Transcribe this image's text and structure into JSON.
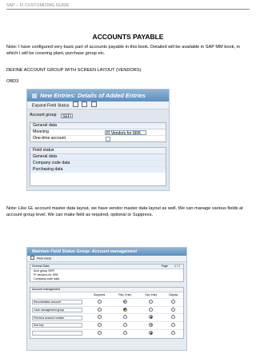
{
  "header": {
    "running_title": "SAP – FI CUSTOMIZING GUIDE"
  },
  "doc": {
    "title": "ACCOUNTS PAYABLE",
    "intro": "Note: I have configured very basic part of accounts payable in this book. Detailed will be available in SAP MM book, in which I will be covering plant, purchase group etc.",
    "section_heading": "DEFINE ACCOUNT GROUP WITH SCREEN LAYOUT (VENDORS)",
    "tcode": "OBD3",
    "note2": "Note: Like GL account master data layout, we have vendor master data layout as well. We can manage various fields at account group level. We can make field as required, optional or Suppress."
  },
  "sap1": {
    "title": "New Entries: Details of Added Entries",
    "toolbar_label": "Expand Field Status",
    "account_group_label": "Account group",
    "account_group_value": "SEFI",
    "general_data": {
      "header": "General data",
      "meaning_label": "Meaning",
      "meaning_value": "FI Vendors for SRK",
      "one_time_label": "One-time account"
    },
    "field_status": {
      "header": "Field status",
      "items": [
        "General data",
        "Company code data",
        "Purchasing data"
      ]
    }
  },
  "sap2": {
    "title": "Maintain Field Status Group: Account management",
    "toolbar_label": "Field check",
    "general_data": {
      "header": "General Data",
      "page_label": "Page",
      "page_value": "1 / 1",
      "lines": [
        "Acct group  SEFI",
        "FI Vendors for SRK",
        "Company code data"
      ]
    },
    "account_management": {
      "header": "Account management",
      "columns": [
        "Suppress",
        "Req. Entry",
        "Opt. entry",
        "Display"
      ],
      "rows": [
        {
          "label": "Reconciliation account",
          "selected": 1
        },
        {
          "label": "Cash management group",
          "selected": 1
        },
        {
          "label": "Previous account number",
          "selected": 2
        },
        {
          "label": "Sort key",
          "selected": 2
        },
        {
          "label": "",
          "selected": 2
        }
      ]
    }
  }
}
